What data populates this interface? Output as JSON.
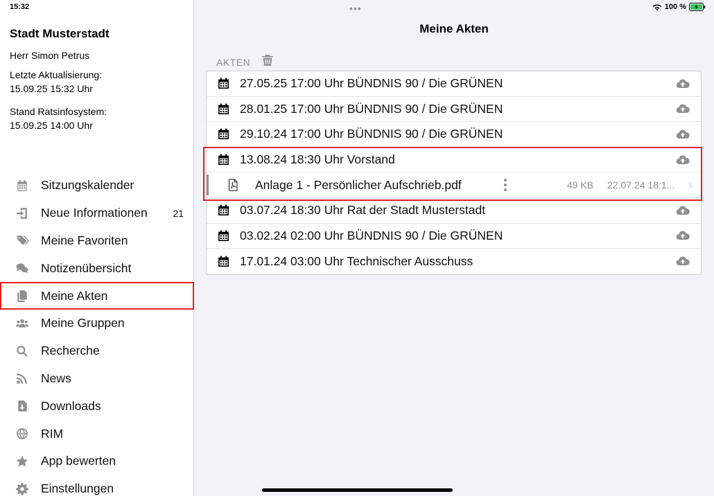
{
  "status": {
    "time": "15:32",
    "battery": "100 %"
  },
  "sidebar": {
    "org_name": "Stadt Musterstadt",
    "user": "Herr Simon Petrus",
    "last_update_label": "Letzte Aktualisierung:",
    "last_update_value": "15.09.25 15:32 Uhr",
    "ris_label": "Stand Ratsinfosystem:",
    "ris_value": "15.09.25 14:00 Uhr",
    "items": [
      {
        "label": "Sitzungskalender",
        "icon": "calendar-icon"
      },
      {
        "label": "Neue Informationen",
        "icon": "sign-in-icon",
        "count": "21"
      },
      {
        "label": "Meine Favoriten",
        "icon": "tags-icon"
      },
      {
        "label": "Notizenübersicht",
        "icon": "comments-icon"
      },
      {
        "label": "Meine Akten",
        "icon": "files-icon",
        "selected": true
      },
      {
        "label": "Meine Gruppen",
        "icon": "users-icon"
      },
      {
        "label": "Recherche",
        "icon": "search-icon"
      },
      {
        "label": "News",
        "icon": "rss-icon"
      },
      {
        "label": "Downloads",
        "icon": "file-download-icon"
      },
      {
        "label": "RIM",
        "icon": "globe-icon"
      },
      {
        "label": "App bewerten",
        "icon": "star-icon"
      },
      {
        "label": "Einstellungen",
        "icon": "gear-icon"
      }
    ]
  },
  "main": {
    "title": "Meine Akten",
    "section": "AKTEN",
    "rows": [
      {
        "text": "27.05.25 17:00 Uhr  BÜNDNIS 90 / Die GRÜNEN"
      },
      {
        "text": "28.01.25 17:00 Uhr  BÜNDNIS 90 / Die GRÜNEN"
      },
      {
        "text": "29.10.24 17:00 Uhr  BÜNDNIS 90 / Die GRÜNEN"
      },
      {
        "text": "13.08.24 18:30 Uhr  Vorstand"
      },
      {
        "sub": true,
        "text": "Anlage 1 - Persönlicher Aufschrieb.pdf",
        "size": "49 KB",
        "date": "22.07.24 18:1..."
      },
      {
        "text": "03.07.24 18:30 Uhr  Rat der Stadt Musterstadt"
      },
      {
        "text": "03.02.24 02:00 Uhr  BÜNDNIS 90 / Die GRÜNEN"
      },
      {
        "text": "17.01.24 03:00 Uhr  Technischer Ausschuss"
      }
    ]
  },
  "colors": {
    "accent_red": "#e02020",
    "icon_gray": "#8e8e93",
    "battery_green": "#34c759"
  }
}
